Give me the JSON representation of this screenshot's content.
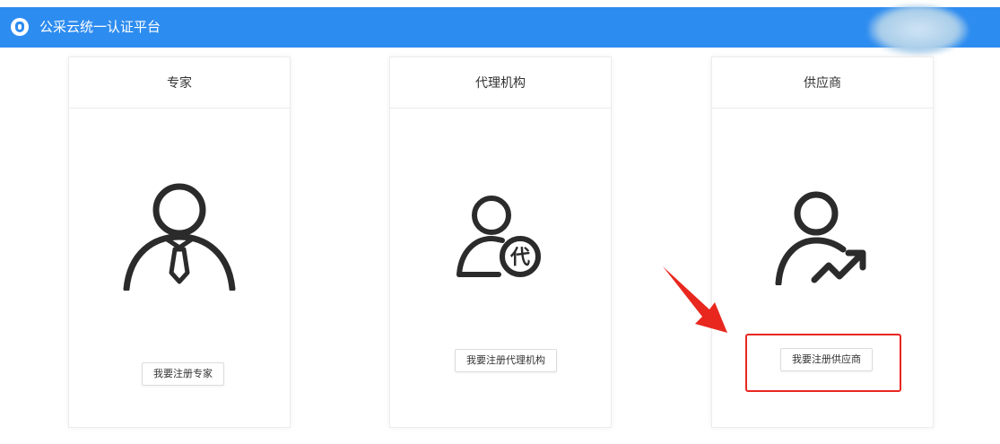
{
  "header": {
    "title": "公采云统一认证平台",
    "bg_color": "#2d8cf0"
  },
  "cards": [
    {
      "title": "专家",
      "icon": "expert-person-tie-icon",
      "button_label": "我要注册专家"
    },
    {
      "title": "代理机构",
      "icon": "agency-person-badge-icon",
      "button_label": "我要注册代理机构",
      "badge_char": "代"
    },
    {
      "title": "供应商",
      "icon": "supplier-person-trend-icon",
      "button_label": "我要注册供应商"
    }
  ],
  "annotation": {
    "highlight_color": "#e8271f",
    "arrow_icon": "red-arrow-icon"
  }
}
